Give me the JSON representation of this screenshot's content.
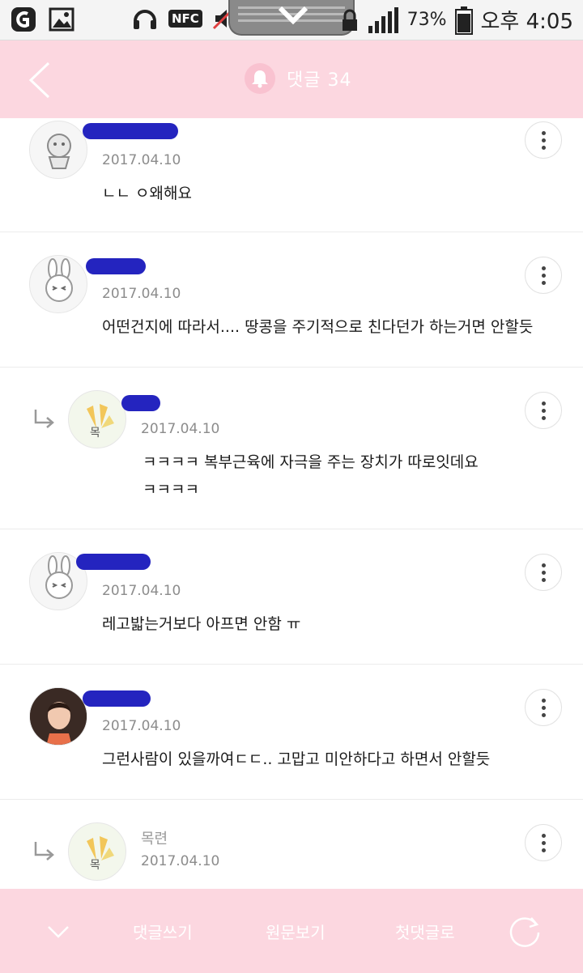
{
  "status_bar": {
    "nfc_label": "NFC",
    "battery_percent": "73%",
    "time": "오후 4:05"
  },
  "header": {
    "title": "댓글 34"
  },
  "comments": [
    {
      "name": "",
      "date": "2017.04.10",
      "text_lines": [
        "ㄴㄴ ㅇ왜해요"
      ]
    },
    {
      "name": "",
      "date": "2017.04.10",
      "text_lines": [
        "어떤건지에 따라서.... 땅콩을 주기적으로 친다던가 하는거면 안할듯"
      ]
    },
    {
      "name": "",
      "date": "2017.04.10",
      "text_lines": [
        "ㅋㅋㅋㅋ 복부근육에 자극을 주는 장치가 따로잇데요",
        "ㅋㅋㅋㅋ"
      ]
    },
    {
      "name": "",
      "date": "2017.04.10",
      "text_lines": [
        "레고밟는거보다 아프면 안함 ㅠ"
      ]
    },
    {
      "name": "",
      "date": "2017.04.10",
      "text_lines": [
        "그런사람이 있을까여ㄷㄷ.. 고맙고 미안하다고 하면서 안할듯"
      ]
    },
    {
      "name": "목련",
      "date": "2017.04.10",
      "text_lines": [
        ""
      ]
    }
  ],
  "bottom_bar": {
    "write_comment": "댓글쓰기",
    "view_original": "원문보기",
    "first_comment": "첫댓글로"
  },
  "colors": {
    "header_pink": "#fcd7e0",
    "redaction_blue": "#2424bf",
    "text_dark": "#1a1a1a",
    "date_gray": "#8c8c8c"
  }
}
